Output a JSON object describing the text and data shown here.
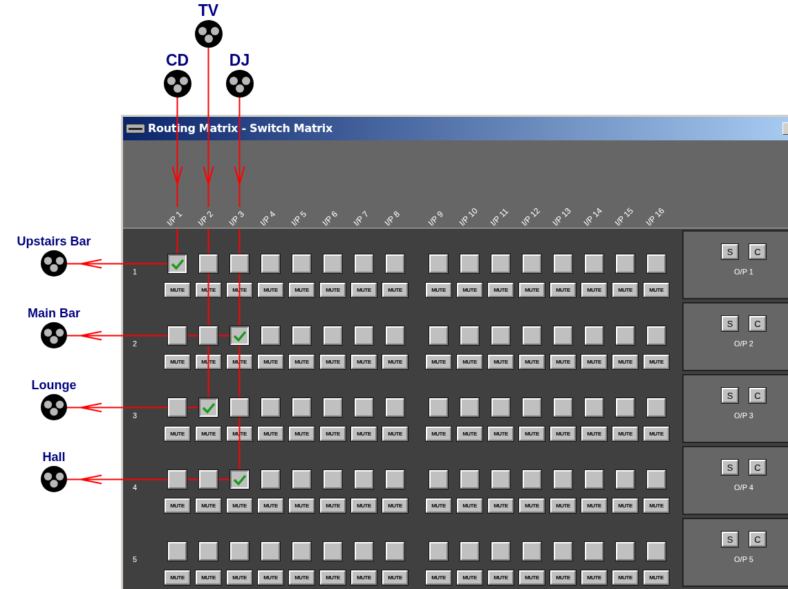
{
  "window": {
    "title": "Routing Matrix - Switch Matrix"
  },
  "inputs": [
    {
      "label": "I/P 1"
    },
    {
      "label": "I/P 2"
    },
    {
      "label": "I/P 3"
    },
    {
      "label": "I/P 4"
    },
    {
      "label": "I/P 5"
    },
    {
      "label": "I/P 6"
    },
    {
      "label": "I/P 7"
    },
    {
      "label": "I/P 8"
    },
    {
      "label": "I/P 9"
    },
    {
      "label": "I/P 10"
    },
    {
      "label": "I/P 11"
    },
    {
      "label": "I/P 12"
    },
    {
      "label": "I/P 13"
    },
    {
      "label": "I/P 14"
    },
    {
      "label": "I/P 15"
    },
    {
      "label": "I/P 16"
    }
  ],
  "rows": [
    {
      "number": "1",
      "output": {
        "label": "O/P 1",
        "buttons": [
          "S",
          "C"
        ]
      },
      "cells": [
        {
          "checked": true,
          "mute": "MUTE"
        },
        {
          "checked": false,
          "mute": "MUTE"
        },
        {
          "checked": false,
          "mute": "MUTE"
        },
        {
          "checked": false,
          "mute": "MUTE"
        },
        {
          "checked": false,
          "mute": "MUTE"
        },
        {
          "checked": false,
          "mute": "MUTE"
        },
        {
          "checked": false,
          "mute": "MUTE"
        },
        {
          "checked": false,
          "mute": "MUTE"
        },
        {
          "checked": false,
          "mute": "MUTE"
        },
        {
          "checked": false,
          "mute": "MUTE"
        },
        {
          "checked": false,
          "mute": "MUTE"
        },
        {
          "checked": false,
          "mute": "MUTE"
        },
        {
          "checked": false,
          "mute": "MUTE"
        },
        {
          "checked": false,
          "mute": "MUTE"
        },
        {
          "checked": false,
          "mute": "MUTE"
        },
        {
          "checked": false,
          "mute": "MUTE"
        }
      ]
    },
    {
      "number": "2",
      "output": {
        "label": "O/P 2",
        "buttons": [
          "S",
          "C"
        ]
      },
      "cells": [
        {
          "checked": false,
          "mute": "MUTE"
        },
        {
          "checked": false,
          "mute": "MUTE"
        },
        {
          "checked": true,
          "mute": "MUTE"
        },
        {
          "checked": false,
          "mute": "MUTE"
        },
        {
          "checked": false,
          "mute": "MUTE"
        },
        {
          "checked": false,
          "mute": "MUTE"
        },
        {
          "checked": false,
          "mute": "MUTE"
        },
        {
          "checked": false,
          "mute": "MUTE"
        },
        {
          "checked": false,
          "mute": "MUTE"
        },
        {
          "checked": false,
          "mute": "MUTE"
        },
        {
          "checked": false,
          "mute": "MUTE"
        },
        {
          "checked": false,
          "mute": "MUTE"
        },
        {
          "checked": false,
          "mute": "MUTE"
        },
        {
          "checked": false,
          "mute": "MUTE"
        },
        {
          "checked": false,
          "mute": "MUTE"
        },
        {
          "checked": false,
          "mute": "MUTE"
        }
      ]
    },
    {
      "number": "3",
      "output": {
        "label": "O/P 3",
        "buttons": [
          "S",
          "C"
        ]
      },
      "cells": [
        {
          "checked": false,
          "mute": "MUTE"
        },
        {
          "checked": true,
          "mute": "MUTE"
        },
        {
          "checked": false,
          "mute": "MUTE"
        },
        {
          "checked": false,
          "mute": "MUTE"
        },
        {
          "checked": false,
          "mute": "MUTE"
        },
        {
          "checked": false,
          "mute": "MUTE"
        },
        {
          "checked": false,
          "mute": "MUTE"
        },
        {
          "checked": false,
          "mute": "MUTE"
        },
        {
          "checked": false,
          "mute": "MUTE"
        },
        {
          "checked": false,
          "mute": "MUTE"
        },
        {
          "checked": false,
          "mute": "MUTE"
        },
        {
          "checked": false,
          "mute": "MUTE"
        },
        {
          "checked": false,
          "mute": "MUTE"
        },
        {
          "checked": false,
          "mute": "MUTE"
        },
        {
          "checked": false,
          "mute": "MUTE"
        },
        {
          "checked": false,
          "mute": "MUTE"
        }
      ]
    },
    {
      "number": "4",
      "output": {
        "label": "O/P 4",
        "buttons": [
          "S",
          "C"
        ]
      },
      "cells": [
        {
          "checked": false,
          "mute": "MUTE"
        },
        {
          "checked": false,
          "mute": "MUTE"
        },
        {
          "checked": true,
          "mute": "MUTE"
        },
        {
          "checked": false,
          "mute": "MUTE"
        },
        {
          "checked": false,
          "mute": "MUTE"
        },
        {
          "checked": false,
          "mute": "MUTE"
        },
        {
          "checked": false,
          "mute": "MUTE"
        },
        {
          "checked": false,
          "mute": "MUTE"
        },
        {
          "checked": false,
          "mute": "MUTE"
        },
        {
          "checked": false,
          "mute": "MUTE"
        },
        {
          "checked": false,
          "mute": "MUTE"
        },
        {
          "checked": false,
          "mute": "MUTE"
        },
        {
          "checked": false,
          "mute": "MUTE"
        },
        {
          "checked": false,
          "mute": "MUTE"
        },
        {
          "checked": false,
          "mute": "MUTE"
        },
        {
          "checked": false,
          "mute": "MUTE"
        }
      ]
    },
    {
      "number": "5",
      "output": {
        "label": "O/P 5",
        "buttons": [
          "S",
          "C"
        ]
      },
      "cells": [
        {
          "checked": false,
          "mute": "MUTE"
        },
        {
          "checked": false,
          "mute": "MUTE"
        },
        {
          "checked": false,
          "mute": "MUTE"
        },
        {
          "checked": false,
          "mute": "MUTE"
        },
        {
          "checked": false,
          "mute": "MUTE"
        },
        {
          "checked": false,
          "mute": "MUTE"
        },
        {
          "checked": false,
          "mute": "MUTE"
        },
        {
          "checked": false,
          "mute": "MUTE"
        },
        {
          "checked": false,
          "mute": "MUTE"
        },
        {
          "checked": false,
          "mute": "MUTE"
        },
        {
          "checked": false,
          "mute": "MUTE"
        },
        {
          "checked": false,
          "mute": "MUTE"
        },
        {
          "checked": false,
          "mute": "MUTE"
        },
        {
          "checked": false,
          "mute": "MUTE"
        },
        {
          "checked": false,
          "mute": "MUTE"
        },
        {
          "checked": false,
          "mute": "MUTE"
        }
      ]
    }
  ],
  "sources": [
    {
      "label": "CD"
    },
    {
      "label": "TV"
    },
    {
      "label": "DJ"
    }
  ],
  "destinations": [
    {
      "label": "Upstairs Bar"
    },
    {
      "label": "Main Bar"
    },
    {
      "label": "Lounge"
    },
    {
      "label": "Hall"
    }
  ]
}
